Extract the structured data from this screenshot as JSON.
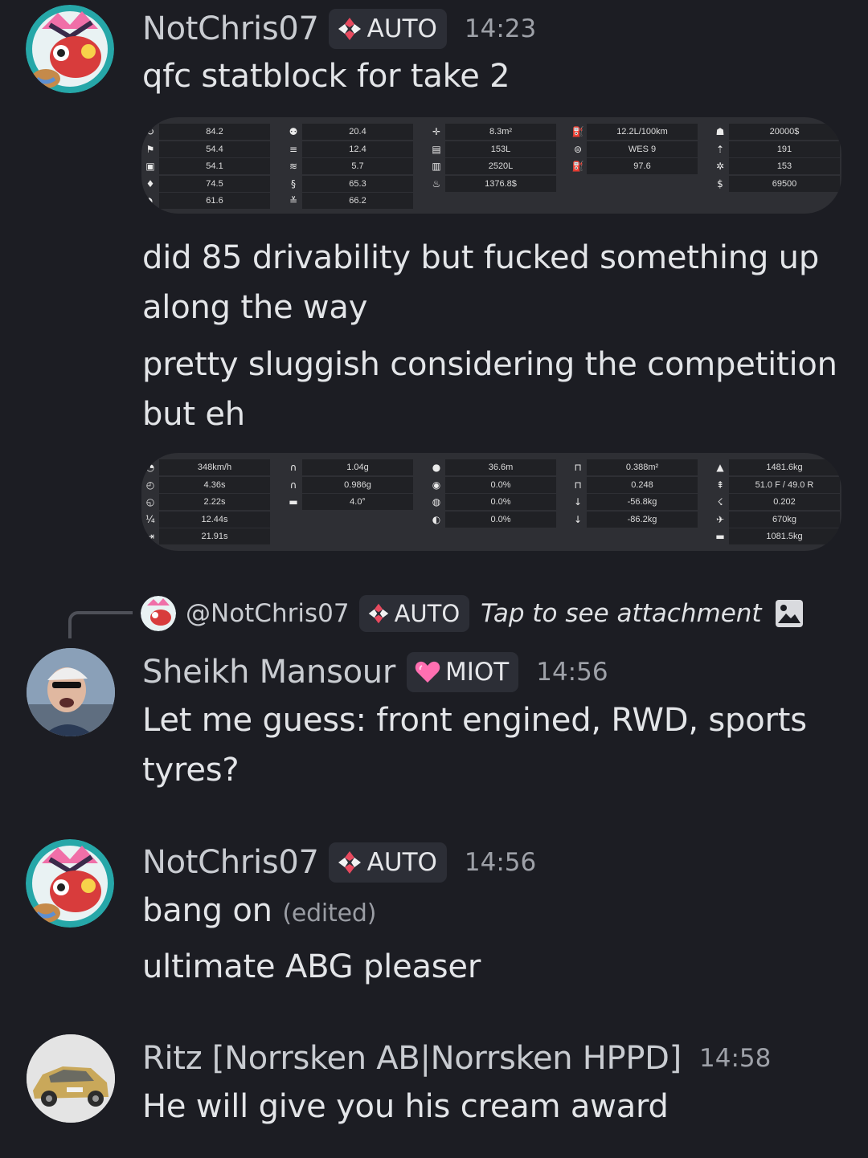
{
  "messages": {
    "m1": {
      "author": "NotChris07",
      "tag": "AUTO",
      "time": "14:23",
      "lines": [
        "qfc statblock for take 2"
      ],
      "after_lines": [
        "did 85 drivability but fucked something up",
        "along the way",
        "pretty sluggish considering the competition",
        "but eh"
      ]
    },
    "reply": {
      "to": "@NotChris07",
      "tag": "AUTO",
      "text": "Tap to see attachment"
    },
    "m2": {
      "author": "Sheikh Mansour",
      "tag": "MIOT",
      "time": "14:56",
      "lines": [
        "Let me guess: front engined, RWD, sports",
        "tyres?"
      ]
    },
    "m3": {
      "author": "NotChris07",
      "tag": "AUTO",
      "time": "14:56",
      "lines": [
        "bang on",
        "ultimate ABG pleaser"
      ],
      "edited": "(edited)"
    },
    "m4": {
      "author": "Ritz [Norrsken AB|Norrsken HPPD]",
      "time": "14:58",
      "lines": [
        "He will give you his cream award"
      ]
    }
  },
  "statblock1": [
    {
      "icons": [
        "↻",
        "⚑",
        "▣",
        "♦",
        "◗"
      ],
      "values": [
        "84.2",
        "54.4",
        "54.1",
        "74.5",
        "61.6"
      ]
    },
    {
      "icons": [
        "⚉",
        "≡",
        "≋",
        "§",
        "≚"
      ],
      "values": [
        "20.4",
        "12.4",
        "5.7",
        "65.3",
        "66.2"
      ]
    },
    {
      "icons": [
        "✛",
        "▤",
        "▥",
        "♨"
      ],
      "values": [
        "8.3m²",
        "153L",
        "2520L",
        "1376.8$"
      ]
    },
    {
      "icons": [
        "⛽",
        "⊜",
        "⛽"
      ],
      "values": [
        "12.2L/100km",
        "WES 9",
        "97.6"
      ]
    },
    {
      "icons": [
        "☗",
        "⇡",
        "✲",
        "$"
      ],
      "values": [
        "20000$",
        "191",
        "153",
        "69500"
      ]
    }
  ],
  "statblock2": [
    {
      "icons": [
        "◔",
        "◴",
        "◵",
        "¼",
        "⇥"
      ],
      "values": [
        "348km/h",
        "4.36s",
        "2.22s",
        "12.44s",
        "21.91s"
      ]
    },
    {
      "icons": [
        "∩",
        "∩",
        "▬"
      ],
      "values": [
        "1.04g",
        "0.986g",
        "4.0°"
      ]
    },
    {
      "icons": [
        "●",
        "◉",
        "◍",
        "◐"
      ],
      "values": [
        "36.6m",
        "0.0%",
        "0.0%",
        "0.0%"
      ]
    },
    {
      "icons": [
        "⊓",
        "⊓",
        "↓",
        "↓"
      ],
      "values": [
        "0.388m²",
        "0.248",
        "-56.8kg",
        "-86.2kg"
      ]
    },
    {
      "icons": [
        "▲",
        "⇞",
        "☇",
        "✈",
        "▬"
      ],
      "values": [
        "1481.6kg",
        "51.0 F / 49.0 R",
        "0.202",
        "670kg",
        "1081.5kg"
      ]
    }
  ],
  "colors": {
    "background": "#1c1d23",
    "tag_bg": "#2c2e36",
    "statblock_bg": "#2e2f34",
    "value_cell": "#202125",
    "miot_heart": "#ff6fb1"
  }
}
